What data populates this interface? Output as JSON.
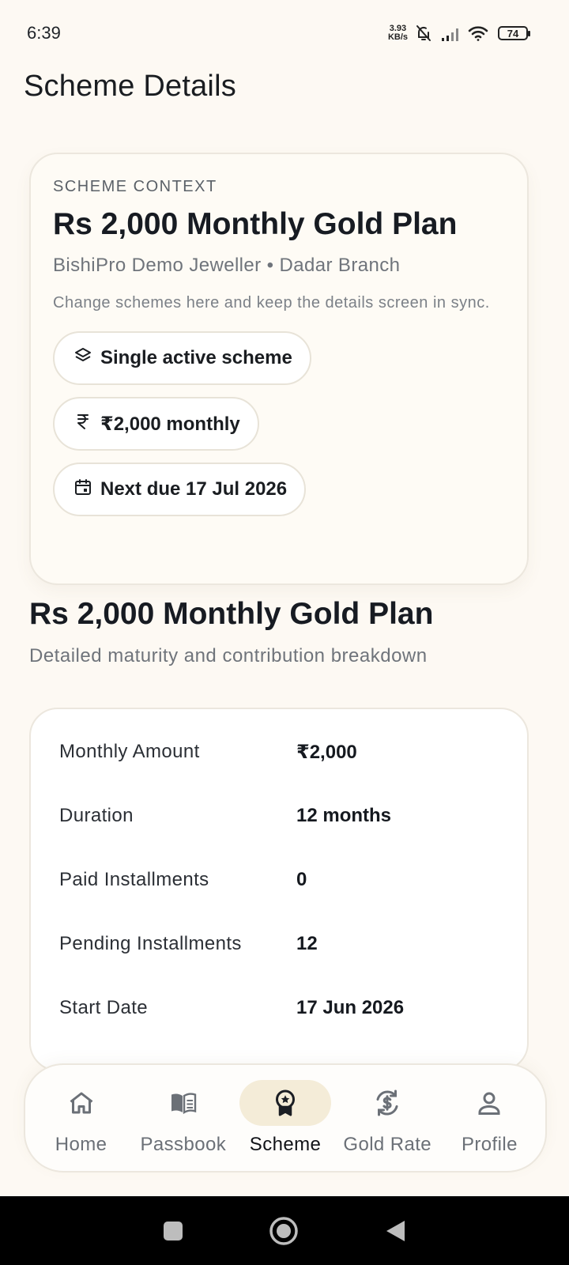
{
  "status_bar": {
    "time": "6:39",
    "net_speed_value": "3.93",
    "net_speed_unit": "KB/s",
    "battery": "74",
    "icons": [
      "bell-off-icon",
      "signal-icon",
      "wifi-icon",
      "battery-icon"
    ]
  },
  "page": {
    "title": "Scheme Details"
  },
  "context": {
    "eyebrow": "SCHEME CONTEXT",
    "title": "Rs 2,000 Monthly Gold Plan",
    "subtitle": "BishiPro Demo Jeweller • Dadar Branch",
    "note": "Change schemes here and keep the details screen in sync.",
    "chips": [
      {
        "icon": "layers-icon",
        "label": "Single active scheme"
      },
      {
        "icon": "rupee-icon",
        "label": "₹2,000 monthly"
      },
      {
        "icon": "calendar-icon",
        "label": "Next due 17 Jul 2026"
      }
    ]
  },
  "plan": {
    "title": "Rs 2,000 Monthly Gold Plan",
    "subtitle": "Detailed maturity and contribution breakdown",
    "rows": [
      {
        "label": "Monthly Amount",
        "value": "₹2,000"
      },
      {
        "label": "Duration",
        "value": "12 months"
      },
      {
        "label": "Paid Installments",
        "value": "0"
      },
      {
        "label": "Pending Installments",
        "value": "12"
      },
      {
        "label": "Start Date",
        "value": "17 Jun 2026"
      }
    ]
  },
  "bottom_nav": {
    "items": [
      {
        "label": "Home",
        "icon": "home-icon",
        "active": false
      },
      {
        "label": "Passbook",
        "icon": "book-icon",
        "active": false
      },
      {
        "label": "Scheme",
        "icon": "award-icon",
        "active": true
      },
      {
        "label": "Gold Rate",
        "icon": "currency-exchange-icon",
        "active": false
      },
      {
        "label": "Profile",
        "icon": "user-icon",
        "active": false
      }
    ]
  },
  "colors": {
    "background": "#FDF9F3",
    "active_nav_pill": "#F4ECD8",
    "text_primary": "#171B22",
    "text_muted": "#6F747B"
  }
}
